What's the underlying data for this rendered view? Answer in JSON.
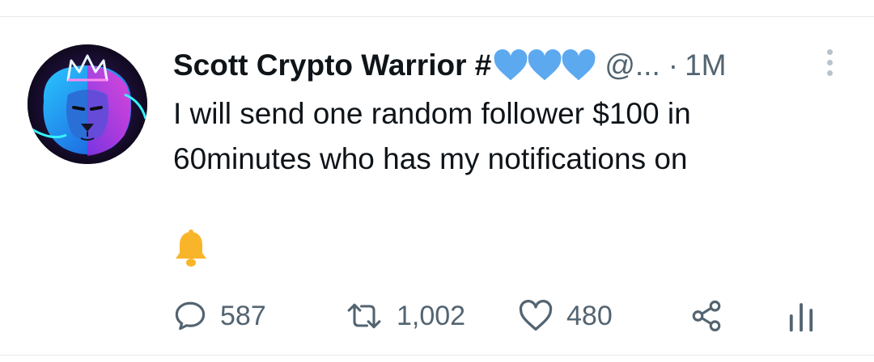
{
  "tweet": {
    "author": {
      "name": "Scott Crypto Warrior #",
      "emoji": [
        "blue-heart",
        "blue-heart",
        "blue-heart"
      ],
      "handle": "@...",
      "separator": "·",
      "time": "1M",
      "avatar": "lion-with-neon-crown"
    },
    "text_lines": [
      "I will send one random follower $100 in",
      "60minutes who has my notifications on"
    ],
    "emoji_after_text": "bell",
    "actions": {
      "reply_count": "587",
      "retweet_count": "1,002",
      "like_count": "480"
    }
  },
  "colors": {
    "text": "#0f1419",
    "secondary": "#536471",
    "heart_blue": "#5da9f0",
    "bell": "#f9b52a",
    "divider": "#e6e9eb"
  }
}
